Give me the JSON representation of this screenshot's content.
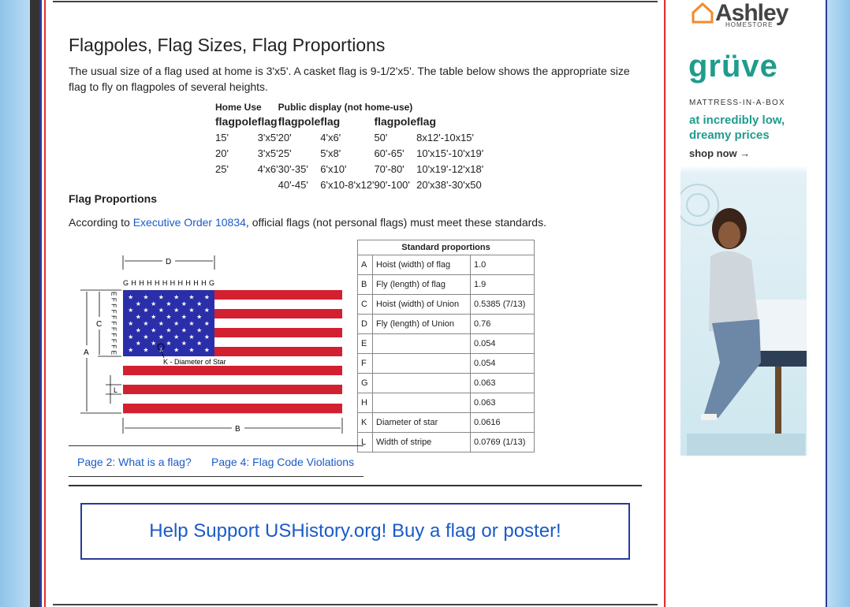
{
  "page": {
    "title": "Flagpoles, Flag Sizes, Flag Proportions",
    "intro": "The usual size of a flag used at home is 3'x5'. A casket flag is 9-1/2'x5'. The table below shows the appropriate size flag to fly on flagpoles of several heights."
  },
  "sizes_table": {
    "group_home": "Home Use",
    "group_public": "Public display (not home-use)",
    "headers": [
      "flagpole",
      "flag",
      "flagpole",
      "flag",
      "flagpole",
      "flag"
    ],
    "rows": [
      [
        "15'",
        "3'x5'",
        "20'",
        "4'x6'",
        "50'",
        "8x12'-10x15'"
      ],
      [
        "20'",
        "3'x5'",
        "25'",
        "5'x8'",
        "60'-65'",
        "10'x15'-10'x19'"
      ],
      [
        "25'",
        "4'x6'",
        "30'-35'",
        "6'x10'",
        "70'-80'",
        "10'x19'-12'x18'"
      ],
      [
        "",
        "",
        "40'-45'",
        "6'x10-8'x12'",
        "90'-100'",
        "20'x38'-30'x50"
      ]
    ]
  },
  "proportions": {
    "heading": "Flag Proportions",
    "text_before": "According to ",
    "link": "Executive Order 10834",
    "text_after": ", official flags (not personal flags) must meet these standards.",
    "table_title": "Standard proportions",
    "rows": [
      {
        "key": "A",
        "desc": "Hoist (width) of flag",
        "value": "1.0"
      },
      {
        "key": "B",
        "desc": "Fly (length) of flag",
        "value": "1.9"
      },
      {
        "key": "C",
        "desc": "Hoist (width) of Union",
        "value": "0.5385 (7/13)"
      },
      {
        "key": "D",
        "desc": "Fly (length) of Union",
        "value": "0.76"
      },
      {
        "key": "E",
        "desc": "",
        "value": "0.054"
      },
      {
        "key": "F",
        "desc": "",
        "value": "0.054"
      },
      {
        "key": "G",
        "desc": "",
        "value": "0.063"
      },
      {
        "key": "H",
        "desc": "",
        "value": "0.063"
      },
      {
        "key": "K",
        "desc": "Diameter of star",
        "value": "0.0616"
      },
      {
        "key": "L",
        "desc": "Width of stripe",
        "value": "0.0769 (1/13)"
      }
    ],
    "diagram": {
      "label_d": "D",
      "label_b": "B",
      "label_a": "A",
      "label_c": "C",
      "label_l": "L",
      "label_k": "K - Diameter of Star",
      "g_ticks": "GHHHHHHHHHHG",
      "e_ticks": "EFFFFFFFFFE"
    }
  },
  "nav": {
    "prev": "Page 2: What is a flag?",
    "next": "Page 4: Flag Code Violations"
  },
  "support": {
    "text": "Help Support USHistory.org! Buy a flag or poster!"
  },
  "ad": {
    "brand": "Ashley",
    "brand_sub": "HOMESTORE",
    "product": "grüve",
    "tagline": "MATTRESS-IN-A-BOX",
    "promo": "at incredibly low, dreamy prices",
    "cta": "shop now →"
  },
  "colors": {
    "link": "#1a5bc8",
    "flag_red": "#d22030",
    "flag_blue": "#2a2ea8",
    "frame_red": "#dd3333",
    "frame_blue": "#2a3a9a"
  }
}
